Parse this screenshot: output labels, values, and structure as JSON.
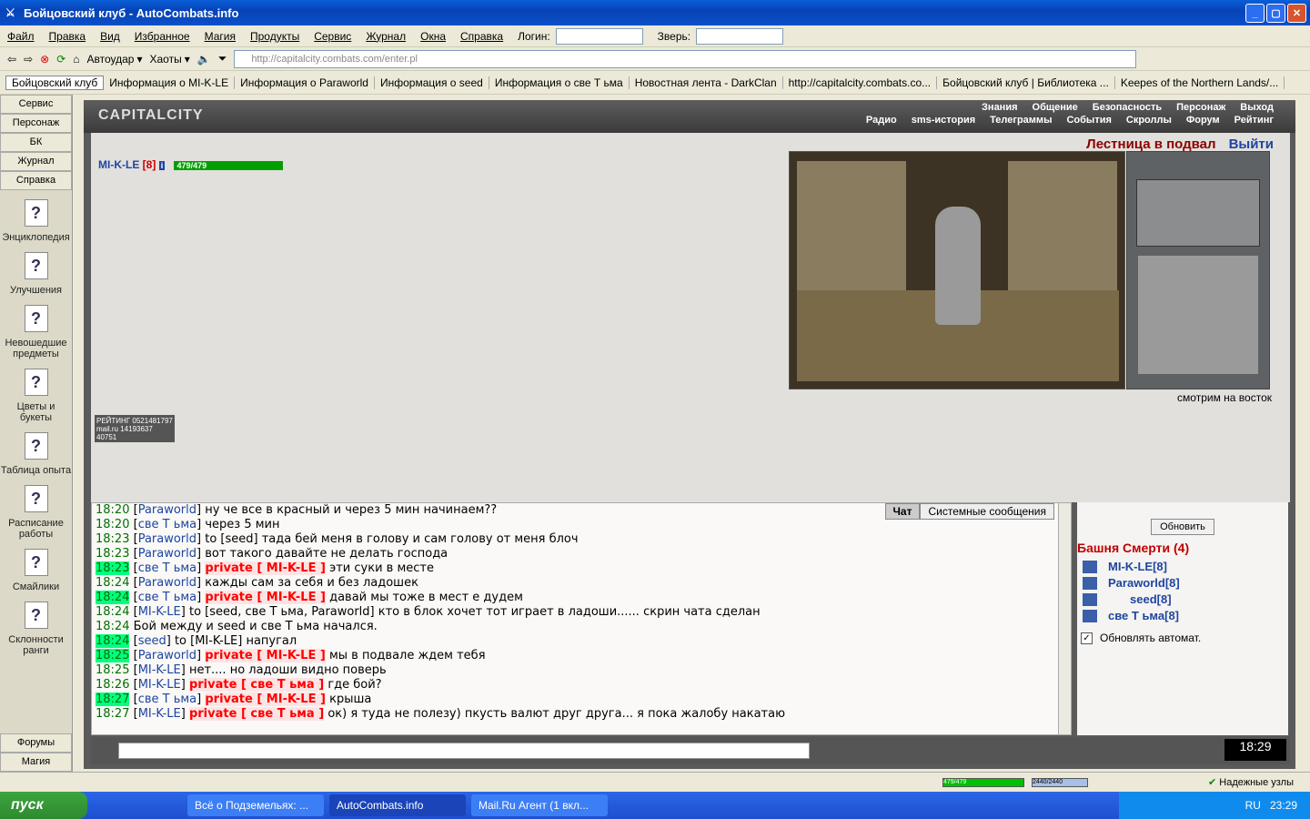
{
  "window": {
    "title": "Бойцовский клуб - AutoCombats.info"
  },
  "menu": {
    "items": [
      "Файл",
      "Правка",
      "Вид",
      "Избранное",
      "Магия",
      "Продукты",
      "Сервис",
      "Журнал",
      "Окна",
      "Справка"
    ],
    "login_label": "Логин:",
    "beast_label": "Зверь:"
  },
  "toolbar": {
    "autohit": "Автоудар",
    "chaos": "Хаоты",
    "url": "http://capitalcity.combats.com/enter.pl"
  },
  "tabs": [
    "Бойцовский клуб",
    "Информация о MI-K-LE",
    "Информация о Paraworld",
    "Информация о seed",
    "Информация о све Т ьма",
    "Новостная лента - DarkClan",
    "http://capitalcity.combats.co...",
    "Бойцовский клуб | Библиотека ...",
    "Keepes of the Northern Lands/..."
  ],
  "sidebar": {
    "buttons": [
      "Сервис",
      "Персонаж",
      "БК",
      "Журнал",
      "Справка"
    ],
    "icons": [
      "Энциклопедия",
      "Улучшения",
      "Невошедшие предметы",
      "Цветы и букеты",
      "Таблица опыта",
      "Расписание работы",
      "Смайлики",
      "Склонности ранги"
    ],
    "bottom": [
      "Форумы",
      "Магия"
    ]
  },
  "game": {
    "logo": "CAPITALCITY",
    "nav1": [
      "Знания",
      "Общение",
      "Безопасность",
      "Персонаж",
      "Выход"
    ],
    "nav2": [
      "Радио",
      "sms-история",
      "Телеграммы",
      "События",
      "Скроллы",
      "Форум",
      "Рейтинг"
    ],
    "location": "Лестница в подвал",
    "exit": "Выйти",
    "player": "MI-K-LE",
    "level": "[8]",
    "hp": "479/479",
    "direction": "смотрим на восток",
    "counter": "РЕЙТИНГ 0521481797 mail.ru 14193637 40751"
  },
  "chat": {
    "tabs": [
      "Чат",
      "Системные сообщения"
    ],
    "lines": [
      {
        "t": "18:20",
        "hl": false,
        "nick": "Paraworld",
        "priv": "",
        "text": "ну че все в красный и через 5 мин начинаем??"
      },
      {
        "t": "18:20",
        "hl": false,
        "nick": "све Т ьма",
        "priv": "",
        "text": "через 5 мин"
      },
      {
        "t": "18:23",
        "hl": false,
        "nick": "Paraworld",
        "priv": "",
        "text": "to [seed] тада бей меня в голову и сам голову от меня блоч"
      },
      {
        "t": "18:23",
        "hl": false,
        "nick": "Paraworld",
        "priv": "",
        "text": "вот такого давайте не делать господа"
      },
      {
        "t": "18:23",
        "hl": true,
        "nick": "све Т ьма",
        "priv": "private [ MI-K-LE ]",
        "text": "эти суки в месте"
      },
      {
        "t": "18:24",
        "hl": false,
        "nick": "Paraworld",
        "priv": "",
        "text": "кажды сам за себя и без ладошек"
      },
      {
        "t": "18:24",
        "hl": true,
        "nick": "све Т ьма",
        "priv": "private [ MI-K-LE ]",
        "text": "давай мы тоже в мест е дудем"
      },
      {
        "t": "18:24",
        "hl": false,
        "nick": "MI-K-LE",
        "priv": "",
        "text": "to [seed, све Т ьма, Paraworld] кто в блок хочет тот играет в ладоши...... скрин чата сделан"
      },
      {
        "t": "18:24",
        "hl": false,
        "nick": "",
        "priv": "",
        "text": "Бой между и seed и све Т ьма начался."
      },
      {
        "t": "18:24",
        "hl": true,
        "nick": "seed",
        "priv": "",
        "text": "to [MI-K-LE] напугал"
      },
      {
        "t": "18:25",
        "hl": true,
        "nick": "Paraworld",
        "priv": "private [ MI-K-LE ]",
        "text": "мы в подвале ждем тебя"
      },
      {
        "t": "18:25",
        "hl": false,
        "nick": "MI-K-LE",
        "priv": "",
        "text": "нет.... но ладоши видно поверь"
      },
      {
        "t": "18:26",
        "hl": false,
        "nick": "MI-K-LE",
        "priv": "private [ све Т ьма ]",
        "text": "где бой?"
      },
      {
        "t": "18:27",
        "hl": true,
        "nick": "све Т ьма",
        "priv": "private [ MI-K-LE ]",
        "text": "крыша"
      },
      {
        "t": "18:27",
        "hl": false,
        "nick": "MI-K-LE",
        "priv": "private [ све Т ьма ]",
        "text": "ок) я туда не полезу) пкусть валют друг друга... я пока жалобу накатаю"
      }
    ]
  },
  "room": {
    "refresh": "Обновить",
    "title": "Башня Смерти (4)",
    "members": [
      "MI-K-LE[8]",
      "Paraworld[8]",
      "seed[8]",
      "све Т ьма[8]"
    ],
    "auto": "Обновлять автомат."
  },
  "clock": "18:29",
  "status": {
    "hp": "479/479",
    "mana": "2440/2440",
    "trust": "Надежные узлы"
  },
  "taskbar": {
    "start": "пуск",
    "tasks": [
      "Всё о Подземельях: ...",
      "AutoCombats.info",
      "Mail.Ru Агент (1 вкл..."
    ],
    "lang": "RU",
    "time": "23:29"
  }
}
